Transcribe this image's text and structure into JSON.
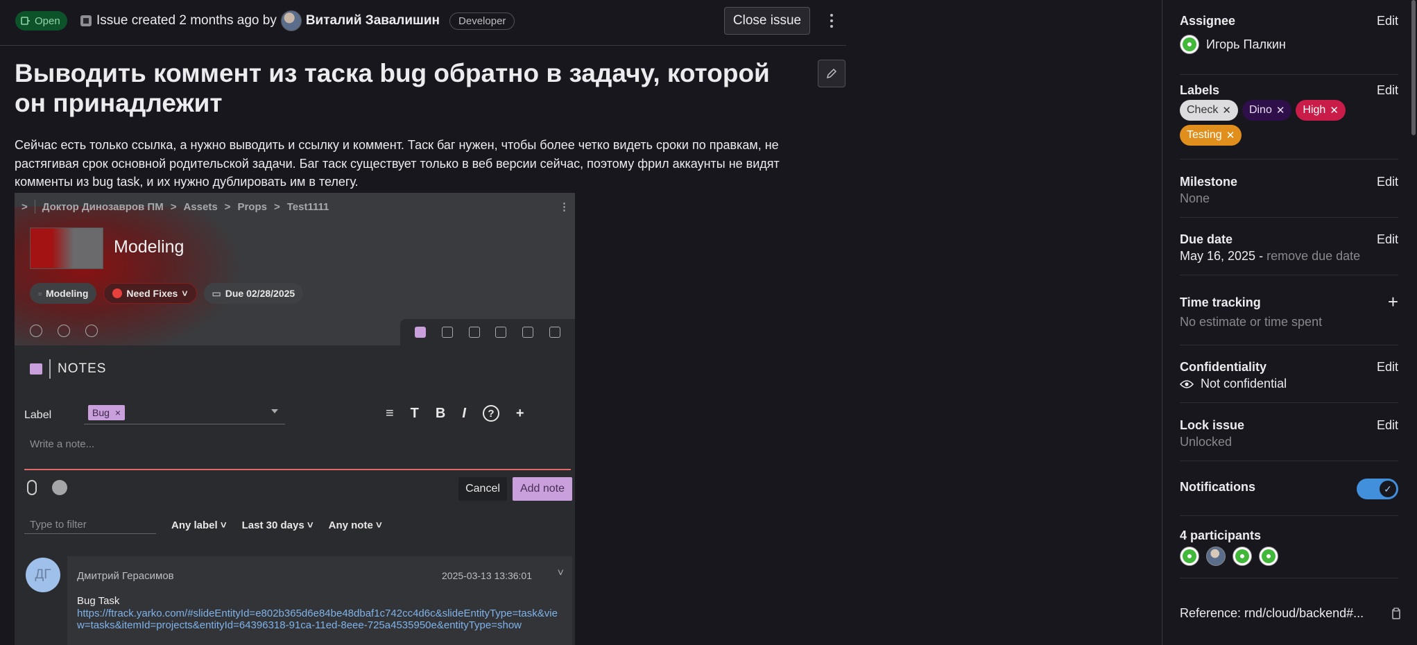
{
  "issue": {
    "status": "Open",
    "meta_prefix": "Issue created 2 months ago by",
    "author": "Виталий Завалишин",
    "role": "Developer",
    "close_button": "Close issue",
    "title": "Выводить коммент из таска bug обратно в задачу, которой он принадлежит",
    "description": "Сейчас есть только ссылка, а нужно выводить и ссылку и коммент. Таск баг нужен, чтобы более четко видеть сроки по правкам, не растягивая срок основной родительской задачи. Баг таск существует только в веб версии сейчас, поэтому фрил аккаунты не видят комменты из bug task, и их нужно дублировать им в телегу."
  },
  "screenshot": {
    "breadcrumb": [
      "Доктор Динозавров ПМ",
      "Assets",
      "Props",
      "Test1111"
    ],
    "breadcrumb_sep": ">",
    "heading": "Modeling",
    "chips": [
      "Modeling",
      "Need Fixes",
      "Due 02/28/2025"
    ],
    "notes_title": "NOTES",
    "label_field": "Label",
    "label_tag": "Bug",
    "format_tools": [
      "≡",
      "T",
      "B",
      "I",
      "?",
      "+"
    ],
    "note_placeholder": "Write a note...",
    "cancel": "Cancel",
    "add_note": "Add note",
    "filter_placeholder": "Type to filter",
    "filters": [
      "Any label",
      "Last 30 days",
      "Any note"
    ],
    "note": {
      "avatar": "ДГ",
      "author": "Дмитрий Герасимов",
      "time": "2025-03-13 13:36:01",
      "title": "Bug Task",
      "link": "https://ftrack.yarko.com/#slideEntityId=e802b365d6e84be48dbaf1c742cc4d6c&slideEntityType=task&view=tasks&itemId=projects&entityId=64396318-91ca-11ed-8eee-725a4535950e&entityType=show"
    }
  },
  "sidebar": {
    "edit": "Edit",
    "assignee": {
      "title": "Assignee",
      "name": "Игорь Палкин"
    },
    "labels": {
      "title": "Labels",
      "items": [
        {
          "text": "Check",
          "bg": "#dcdcde",
          "fg": "#333238"
        },
        {
          "text": "Dino",
          "bg": "#2f0f4a",
          "fg": "#e8dcf2"
        },
        {
          "text": "High",
          "bg": "#c91c48",
          "fg": "#ffffff"
        },
        {
          "text": "Testing",
          "bg": "#e08f1c",
          "fg": "#ffffff"
        }
      ]
    },
    "milestone": {
      "title": "Milestone",
      "value": "None"
    },
    "due_date": {
      "title": "Due date",
      "value": "May 16, 2025",
      "sep": " - ",
      "remove": "remove due date"
    },
    "time_tracking": {
      "title": "Time tracking",
      "value": "No estimate or time spent",
      "add": "+"
    },
    "confidentiality": {
      "title": "Confidentiality",
      "value": "Not confidential"
    },
    "lock": {
      "title": "Lock issue",
      "value": "Unlocked"
    },
    "notifications": {
      "title": "Notifications",
      "enabled": true
    },
    "participants": {
      "title": "4 participants",
      "count": 4
    },
    "reference": "Reference: rnd/cloud/backend#..."
  },
  "colors": {
    "accent": "#428fdc",
    "open_badge": "#0d532a",
    "add_note": "#c9a0dc"
  }
}
